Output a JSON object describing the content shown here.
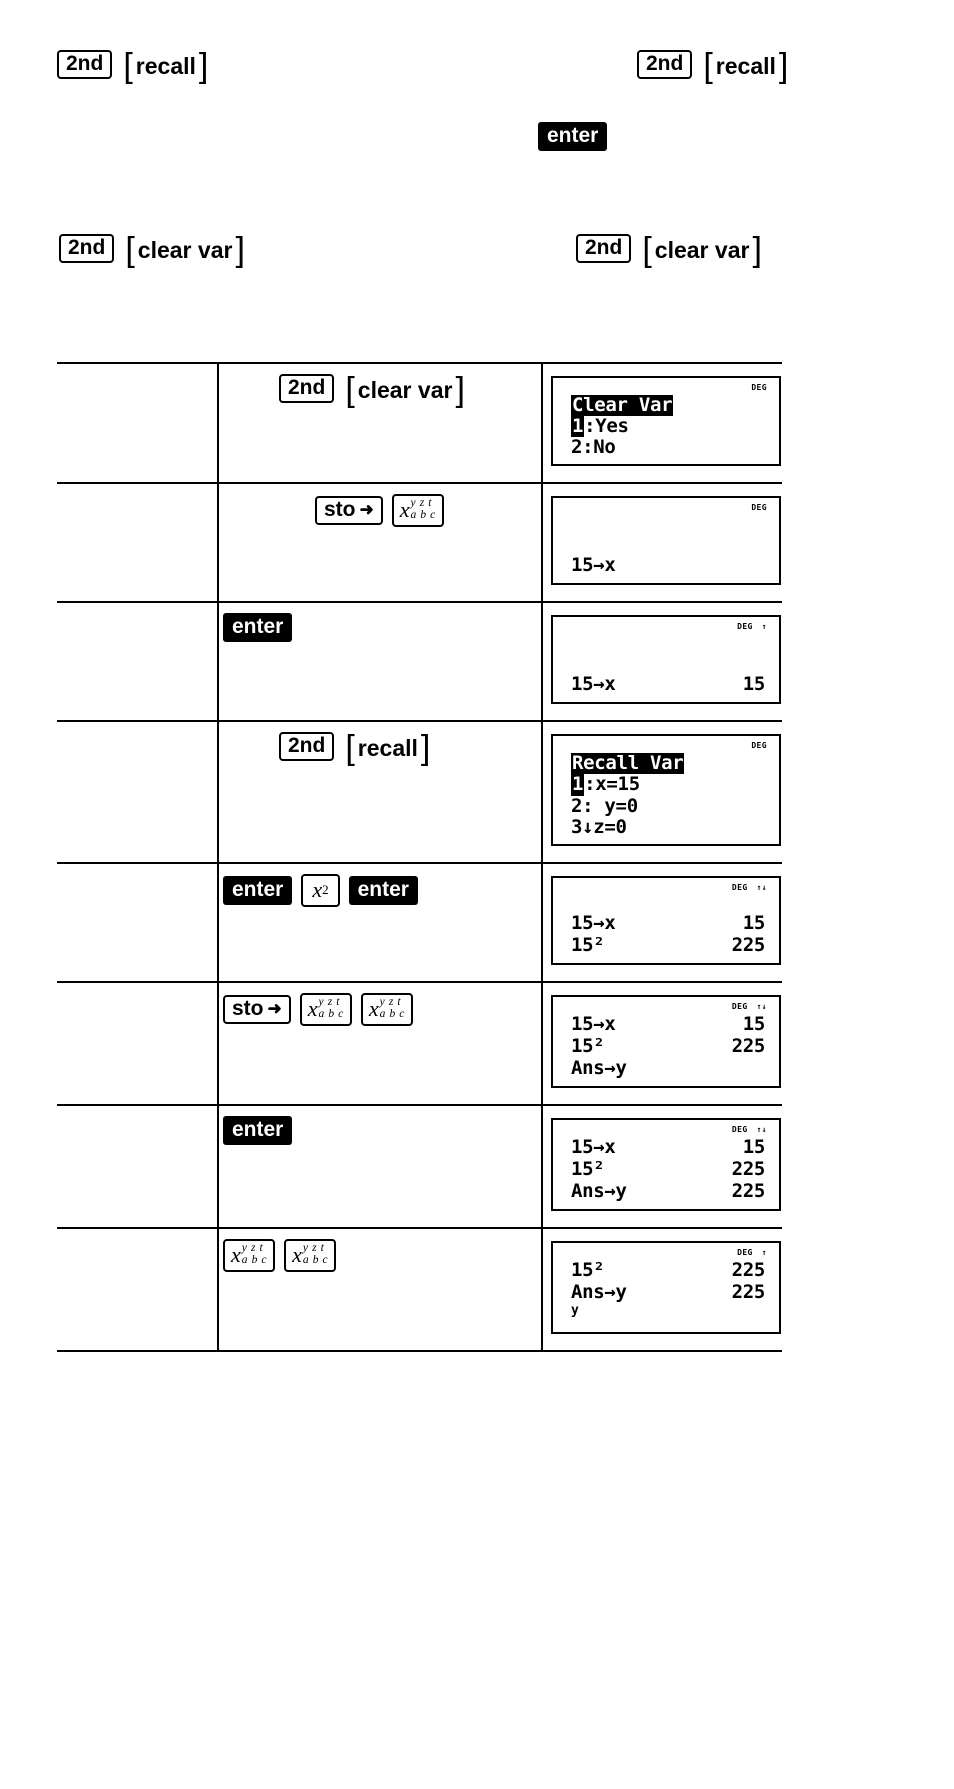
{
  "page": {
    "doc_type": "calculator-key-sequence-reference"
  },
  "keys": {
    "second": "2nd",
    "recall": "recall",
    "clear_var": "clear var",
    "enter": "enter",
    "sto": "sto",
    "sto_arrow": "➜",
    "x_var": "x",
    "x_var_sup": "y z t",
    "x_var_sub": "a b c",
    "x_squared": "x",
    "x_squared_sup": "2"
  },
  "top_sequences": [
    {
      "id": "seq-1",
      "second": "2nd",
      "bracket": "recall"
    },
    {
      "id": "seq-2",
      "second": "2nd",
      "bracket": "recall"
    },
    {
      "id": "seq-3",
      "enter": "enter"
    },
    {
      "id": "seq-4",
      "second": "2nd",
      "bracket": "clear var"
    },
    {
      "id": "seq-5",
      "second": "2nd",
      "bracket": "clear var"
    }
  ],
  "table": {
    "rows": [
      {
        "id": "row-1",
        "keys": [
          {
            "type": "box",
            "label": "2nd"
          },
          {
            "type": "bracket",
            "label": "clear var"
          }
        ],
        "screen": {
          "status": [
            "DEG"
          ],
          "kind": "menu",
          "title": "Clear Var",
          "items": [
            {
              "sel": "1",
              "text": ":Yes"
            },
            {
              "sel": "",
              "text": "2:No"
            }
          ]
        }
      },
      {
        "id": "row-2",
        "keys": [
          {
            "type": "sto",
            "label": "sto"
          },
          {
            "type": "xabc",
            "label": "x"
          }
        ],
        "screen": {
          "status": [
            "DEG"
          ],
          "kind": "lines",
          "lines": [
            {
              "left": "15→x",
              "right": ""
            }
          ]
        }
      },
      {
        "id": "row-3",
        "keys": [
          {
            "type": "inv",
            "label": "enter"
          }
        ],
        "screen": {
          "status": [
            "DEG",
            "↑"
          ],
          "kind": "lines",
          "lines": [
            {
              "left": "15→x",
              "right": "15"
            }
          ]
        }
      },
      {
        "id": "row-4",
        "keys": [
          {
            "type": "box",
            "label": "2nd"
          },
          {
            "type": "bracket",
            "label": "recall"
          }
        ],
        "screen": {
          "status": [
            "DEG"
          ],
          "kind": "menu",
          "title": "Recall Var",
          "items": [
            {
              "sel": "1",
              "text": ":x=15"
            },
            {
              "sel": "",
              "text": "2: y=0"
            },
            {
              "sel": "",
              "text": "3↓z=0"
            }
          ]
        }
      },
      {
        "id": "row-5",
        "keys": [
          {
            "type": "inv",
            "label": "enter"
          },
          {
            "type": "xsq",
            "label": "x",
            "sup": "2"
          },
          {
            "type": "inv",
            "label": "enter"
          }
        ],
        "screen": {
          "status": [
            "DEG",
            "↑↓"
          ],
          "kind": "lines",
          "lines": [
            {
              "left": "15→x",
              "right": "15"
            },
            {
              "left": "15²",
              "right": "225"
            }
          ]
        }
      },
      {
        "id": "row-6",
        "keys": [
          {
            "type": "sto",
            "label": "sto"
          },
          {
            "type": "xabc",
            "label": "x"
          },
          {
            "type": "xabc",
            "label": "x"
          }
        ],
        "screen": {
          "status": [
            "DEG",
            "↑↓"
          ],
          "kind": "lines",
          "lines": [
            {
              "left": "15→x",
              "right": "15"
            },
            {
              "left": "15²",
              "right": "225"
            },
            {
              "left": "Ans→y",
              "right": ""
            }
          ]
        }
      },
      {
        "id": "row-7",
        "keys": [
          {
            "type": "inv",
            "label": "enter"
          }
        ],
        "screen": {
          "status": [
            "DEG",
            "↑↓"
          ],
          "kind": "lines",
          "lines": [
            {
              "left": "15→x",
              "right": "15"
            },
            {
              "left": "15²",
              "right": "225"
            },
            {
              "left": "Ans→y",
              "right": "225"
            }
          ]
        }
      },
      {
        "id": "row-8",
        "keys": [
          {
            "type": "xabc",
            "label": "x"
          },
          {
            "type": "xabc",
            "label": "x"
          }
        ],
        "screen": {
          "status": [
            "DEG",
            "↑"
          ],
          "kind": "lines",
          "lines": [
            {
              "left": "15²",
              "right": "225"
            },
            {
              "left": "Ans→y",
              "right": "225"
            },
            {
              "left": "y",
              "right": "",
              "small": true
            }
          ]
        }
      }
    ]
  }
}
